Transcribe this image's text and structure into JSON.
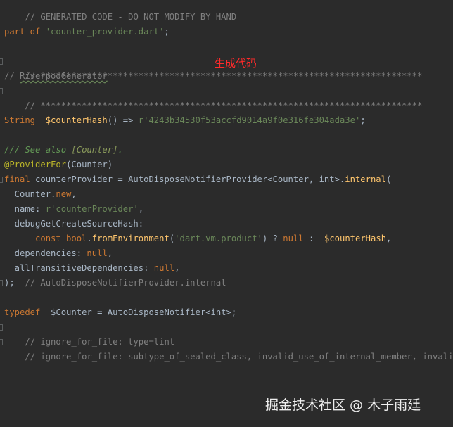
{
  "editor": {
    "lines": {
      "l01": "// GENERATED CODE - DO NOT MODIFY BY HAND",
      "l02_kw": "part of",
      "l02_str": "'counter_provider.dart'",
      "l02_end": ";",
      "l03": "// **************************************************************************",
      "l04_a": "// ",
      "l04_b": "RiverpodGenerator",
      "l05": "// **************************************************************************",
      "l06_type": "String",
      "l06_var": "_$counterHash",
      "l06_mid": "() => ",
      "l06_str": "r'4243b34530f53accfd9014a9f0e316fe304ada3e'",
      "l06_end": ";",
      "l07_a": "/// See also ",
      "l07_b": "[Counter]",
      "l07_c": ".",
      "l08_ann": "@ProviderFor",
      "l08_rest": "(Counter)",
      "l09_kw": "final",
      "l09_mid": " counterProvider = AutoDisposeNotifierProvider<Counter, int>.",
      "l09_fn": "internal",
      "l09_end": "(",
      "l10_a": "  Counter.",
      "l10_kw": "new",
      "l10_end": ",",
      "l11_a": "  name: ",
      "l11_str": "r'counterProvider'",
      "l11_end": ",",
      "l12": "  debugGetCreateSourceHash:",
      "l13_pad": "      ",
      "l13_kw1": "const bool",
      "l13_dot": ".",
      "l13_fn": "fromEnvironment",
      "l13_p1": "(",
      "l13_str": "'dart.vm.product'",
      "l13_p2": ") ? ",
      "l13_null": "null",
      "l13_p3": " : ",
      "l13_var": "_$counterHash",
      "l13_end": ",",
      "l14_a": "  dependencies: ",
      "l14_null": "null",
      "l14_end": ",",
      "l15_a": "  allTransitiveDependencies: ",
      "l15_null": "null",
      "l15_end": ",",
      "l16_a": ");",
      "l16_comment": "  // AutoDisposeNotifierProvider.internal",
      "l17_kw": "typedef",
      "l17_rest": " _$Counter = AutoDisposeNotifier<int>;",
      "l18": "// ignore_for_file: type=lint",
      "l19": "// ignore_for_file: subtype_of_sealed_class, invalid_use_of_internal_member, invalid_use_"
    }
  },
  "overlay": {
    "annotation": "生成代码"
  },
  "watermark": {
    "text": "掘金技术社区 @ 木子雨廷"
  }
}
